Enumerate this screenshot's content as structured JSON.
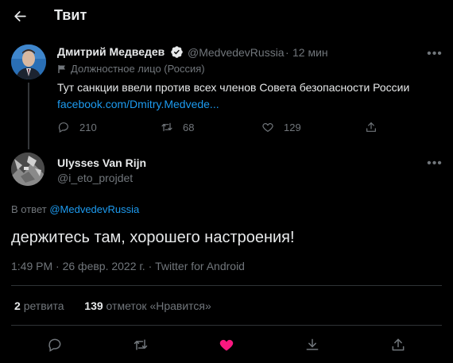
{
  "header": {
    "title": "Твит"
  },
  "parent_tweet": {
    "author_name": "Дмитрий Медведев",
    "author_handle": "@MedvedevRussia",
    "dot": "·",
    "time": "12 мин",
    "label": "Должностное лицо (Россия)",
    "text": "Тут санкции ввели против всех членов Совета безопасности России",
    "link": "facebook.com/Dmitry.Medvede...",
    "replies": "210",
    "retweets": "68",
    "likes": "129"
  },
  "reply": {
    "author_name": "Ulysses Van Rijn",
    "author_handle": "@i_eto_projdet",
    "reply_to_prefix": "В ответ",
    "reply_to_handle": "@MedvedevRussia",
    "text": "держитесь там, хорошего настроения!",
    "time": "1:49 PM",
    "date": "26 февр. 2022 г.",
    "source": "Twitter for Android",
    "retweet_count": "2",
    "retweet_label": "ретвита",
    "like_count": "139",
    "like_label": "отметок «Нравится»"
  },
  "colors": {
    "accent": "#1d9bf0",
    "like": "#f91880",
    "muted": "#71767b",
    "background": "#000000"
  },
  "icons": [
    "back-arrow-icon",
    "verified-badge-icon",
    "flag-icon",
    "more-icon",
    "reply-icon",
    "retweet-icon",
    "like-icon",
    "share-icon"
  ]
}
